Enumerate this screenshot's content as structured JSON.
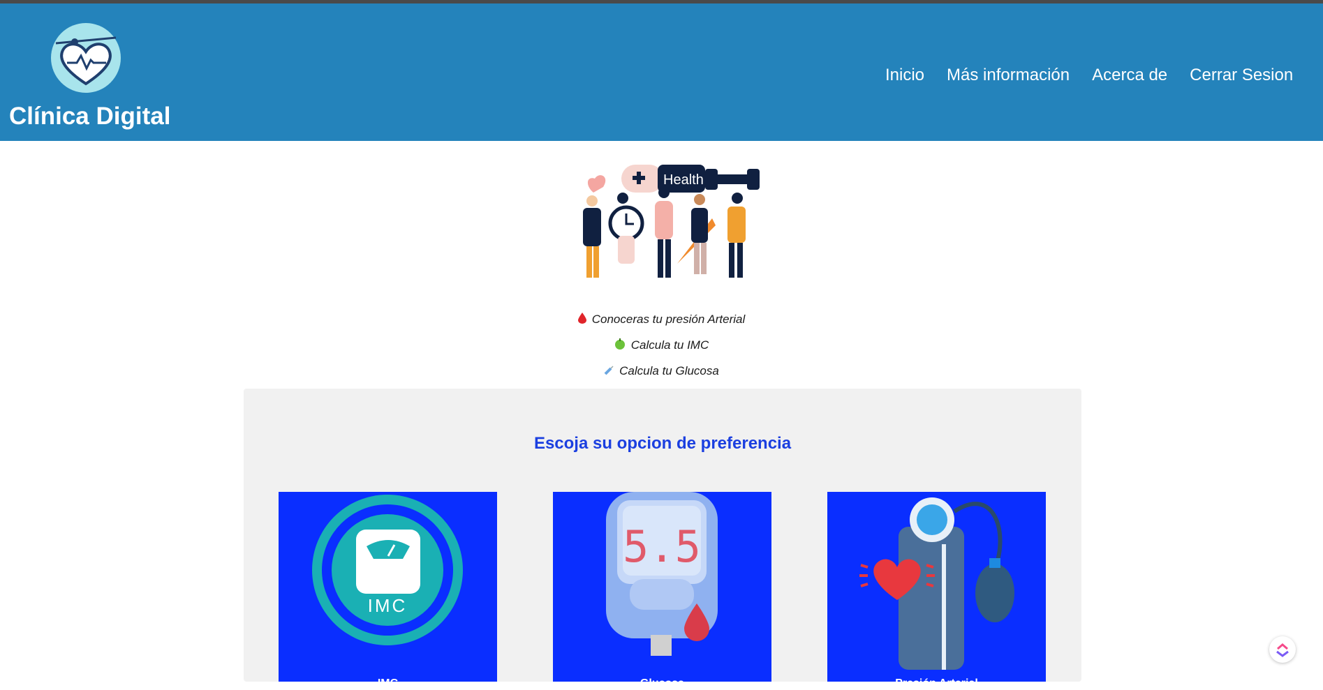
{
  "header": {
    "brand": "Clínica Digital",
    "nav": [
      "Inicio",
      "Más información",
      "Acerca de",
      "Cerrar Sesion"
    ],
    "bg_color": "#2483bb"
  },
  "hero": {
    "illustration_text": "Health"
  },
  "benefits": [
    {
      "icon": "blood-drop-icon",
      "text": "Conoceras tu presión Arterial"
    },
    {
      "icon": "apple-icon",
      "text": "Calcula tu IMC"
    },
    {
      "icon": "syringe-icon",
      "text": "Calcula tu Glucosa"
    }
  ],
  "options": {
    "title": "Escoja su opcion de preferencia",
    "cards": [
      {
        "label": "IMC",
        "icon": "scale-icon",
        "icon_text": "IMC"
      },
      {
        "label": "Glucosa",
        "icon": "glucometer-icon",
        "icon_text": "5.5"
      },
      {
        "label": "Presión Arterial",
        "icon": "blood-pressure-monitor-icon"
      }
    ],
    "accent_color": "#0a2eff",
    "title_color": "#1b3fe0"
  }
}
